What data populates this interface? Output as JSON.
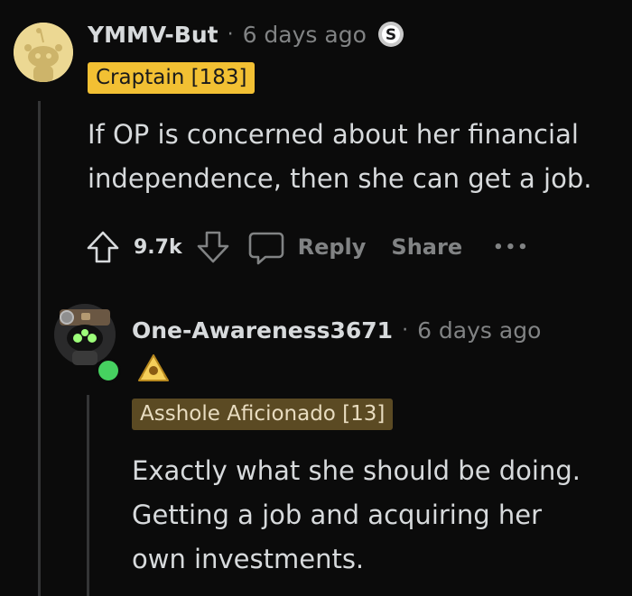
{
  "comments": [
    {
      "username": "YMMV-But",
      "separator": "·",
      "time": "6 days ago",
      "flair": "Craptain [183]",
      "flair_bg": "#f2c033",
      "flair_color": "#1a1a1b",
      "body_lines": [
        "If OP is concerned about her financial",
        "independence, then she can get a job."
      ],
      "badge_icon": "silver-award-icon",
      "avatar_icon": "snoo-avatar-icon",
      "votes": "9.7k",
      "actions": {
        "reply": "Reply",
        "share": "Share",
        "more": "•••"
      }
    },
    {
      "username": "One-Awareness3671",
      "separator": "·",
      "time": "6 days ago",
      "flair": "Asshole Aficionado [13]",
      "flair_bg": "#5b4a23",
      "flair_color": "#e8dcc0",
      "body_lines": [
        "Exactly what she should be doing.",
        "Getting a job and acquiring her",
        "own investments."
      ],
      "badge_icon": "gold-award-icon",
      "avatar_icon": "snoo-avatar-icon",
      "online_status": "online"
    }
  ],
  "colors": {
    "background": "#0b0b0b",
    "text": "#d7dadc",
    "muted": "#818384",
    "thread_line": "#343536",
    "online": "#46d160"
  }
}
